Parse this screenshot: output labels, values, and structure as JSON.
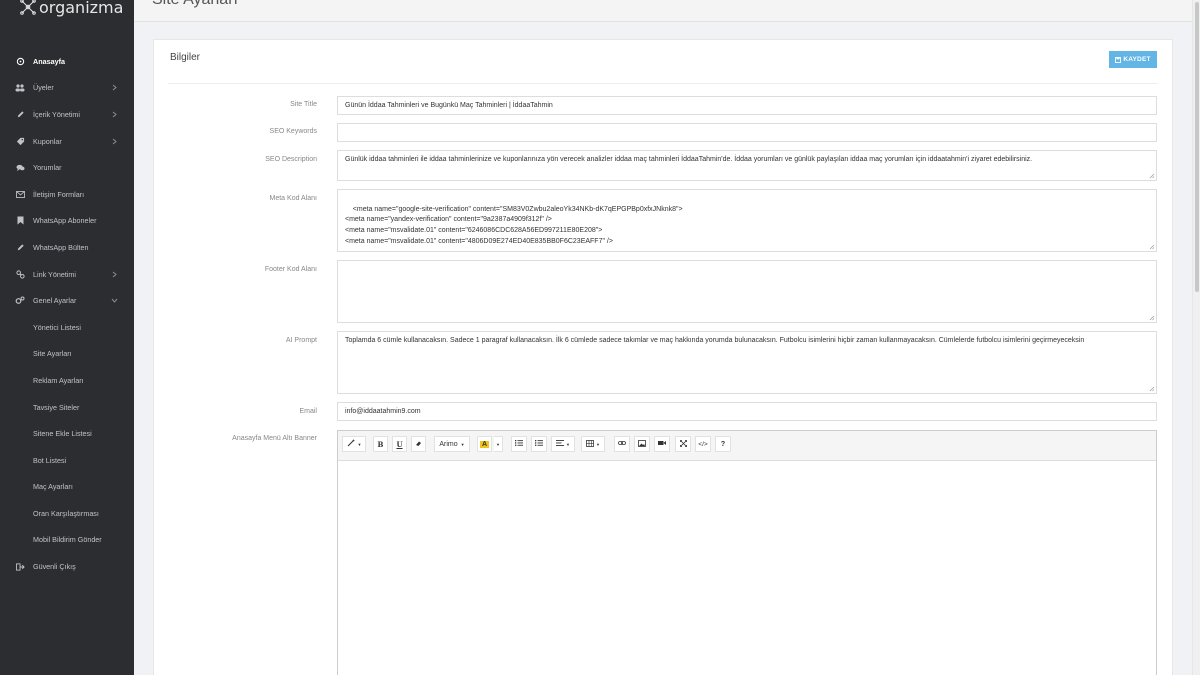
{
  "app": {
    "brand": "organizma"
  },
  "header": {
    "title": "Site Ayarları"
  },
  "sidebar": {
    "items": [
      {
        "label": "Anasayfa",
        "icon": "dashboard-icon",
        "active": true,
        "has_children": false
      },
      {
        "label": "Üyeler",
        "icon": "users-icon",
        "has_children": true
      },
      {
        "label": "İçerik Yönetimi",
        "icon": "pencil-icon",
        "has_children": true
      },
      {
        "label": "Kuponlar",
        "icon": "tag-icon",
        "has_children": true
      },
      {
        "label": "Yorumlar",
        "icon": "comments-icon",
        "has_children": false
      },
      {
        "label": "İletişim Formları",
        "icon": "envelope-icon",
        "has_children": false
      },
      {
        "label": "WhatsApp Aboneler",
        "icon": "bookmark-icon",
        "has_children": false
      },
      {
        "label": "WhatsApp Bülten",
        "icon": "pencil-icon",
        "has_children": false
      },
      {
        "label": "Link Yönetimi",
        "icon": "link-icon",
        "has_children": true
      },
      {
        "label": "Genel Ayarlar",
        "icon": "gears-icon",
        "has_children": true,
        "expanded": true
      }
    ],
    "sub_items": [
      {
        "label": "Yönetici Listesi"
      },
      {
        "label": "Site Ayarları"
      },
      {
        "label": "Reklam Ayarları"
      },
      {
        "label": "Tavsiye Siteler"
      },
      {
        "label": "Sitene Ekle Listesi"
      },
      {
        "label": "Bot Listesi"
      },
      {
        "label": "Maç Ayarları"
      },
      {
        "label": "Oran Karşılaştırması"
      },
      {
        "label": "Mobil Bildirim Gönder"
      }
    ],
    "logout": {
      "label": "Güvenli Çıkış",
      "icon": "sign-out-icon"
    }
  },
  "panel": {
    "title": "Bilgiler",
    "save_label": "KAYDET"
  },
  "form": {
    "site_title": {
      "label": "Site Title",
      "value": "Günün İddaa Tahminleri ve Bugünkü Maç Tahminleri | İddaaTahmin"
    },
    "seo_keywords": {
      "label": "SEO Keywords",
      "value": ""
    },
    "seo_description": {
      "label": "SEO Description",
      "value": "Günlük iddaa tahminleri ile iddaa tahminlerinize ve kuponlarınıza yön verecek analizler iddaa maç tahminleri İddaaTahmin'de. İddaa yorumları ve günlük paylaşılan iddaa maç yorumları için iddaatahmin'i ziyaret edebilirsiniz."
    },
    "meta_code": {
      "label": "Meta Kod Alanı",
      "value": "<meta name=\"google-site-verification\" content=\"SM83V0Zwbu2aleoYk34NKb-dK7qEPGPBp0xfxJNknk8\">\n<meta name=\"yandex-verification\" content=\"9a2387a4909f312f\" />\n<meta name=\"msvalidate.01\" content=\"6246086CDC628A56ED997211E80E208\">\n<meta name=\"msvalidate.01\" content=\"4806D09E274ED40E835BB0F6C23EAFF7\" />"
    },
    "footer_code": {
      "label": "Footer Kod Alanı",
      "value": ""
    },
    "ai_prompt": {
      "label": "AI Prompt",
      "value": "Toplamda 6 cümle kullanacaksın. Sadece 1 paragraf kullanacaksın. İlk 6 cümlede sadece takımlar ve maç hakkında yorumda bulunacaksın. Futbolcu isimlerini hiçbir zaman kullanmayacaksın. Cümlelerde futbolcu isimlerini geçirmeyeceksin"
    },
    "email": {
      "label": "Email",
      "value": "info@iddaatahmin9.com"
    },
    "banner": {
      "label": "Anasayfa Menü Altı Banner"
    }
  },
  "editor_toolbar": {
    "font_name": "Arimo",
    "buttons": [
      "magic-icon",
      "bold-icon",
      "underline-icon",
      "eraser-icon",
      "font-name",
      "color-icon",
      "ul-icon",
      "ol-icon",
      "align-icon",
      "table-icon",
      "link-icon",
      "picture-icon",
      "video-icon",
      "fullscreen-icon",
      "code-icon",
      "help-icon"
    ],
    "bold_glyph": "B",
    "underline_glyph": "U",
    "code_glyph": "</>",
    "help_glyph": "?"
  },
  "colors": {
    "sidebar_bg": "#2b2d30",
    "accent": "#62b5e5",
    "highlight": "#f0c419"
  }
}
